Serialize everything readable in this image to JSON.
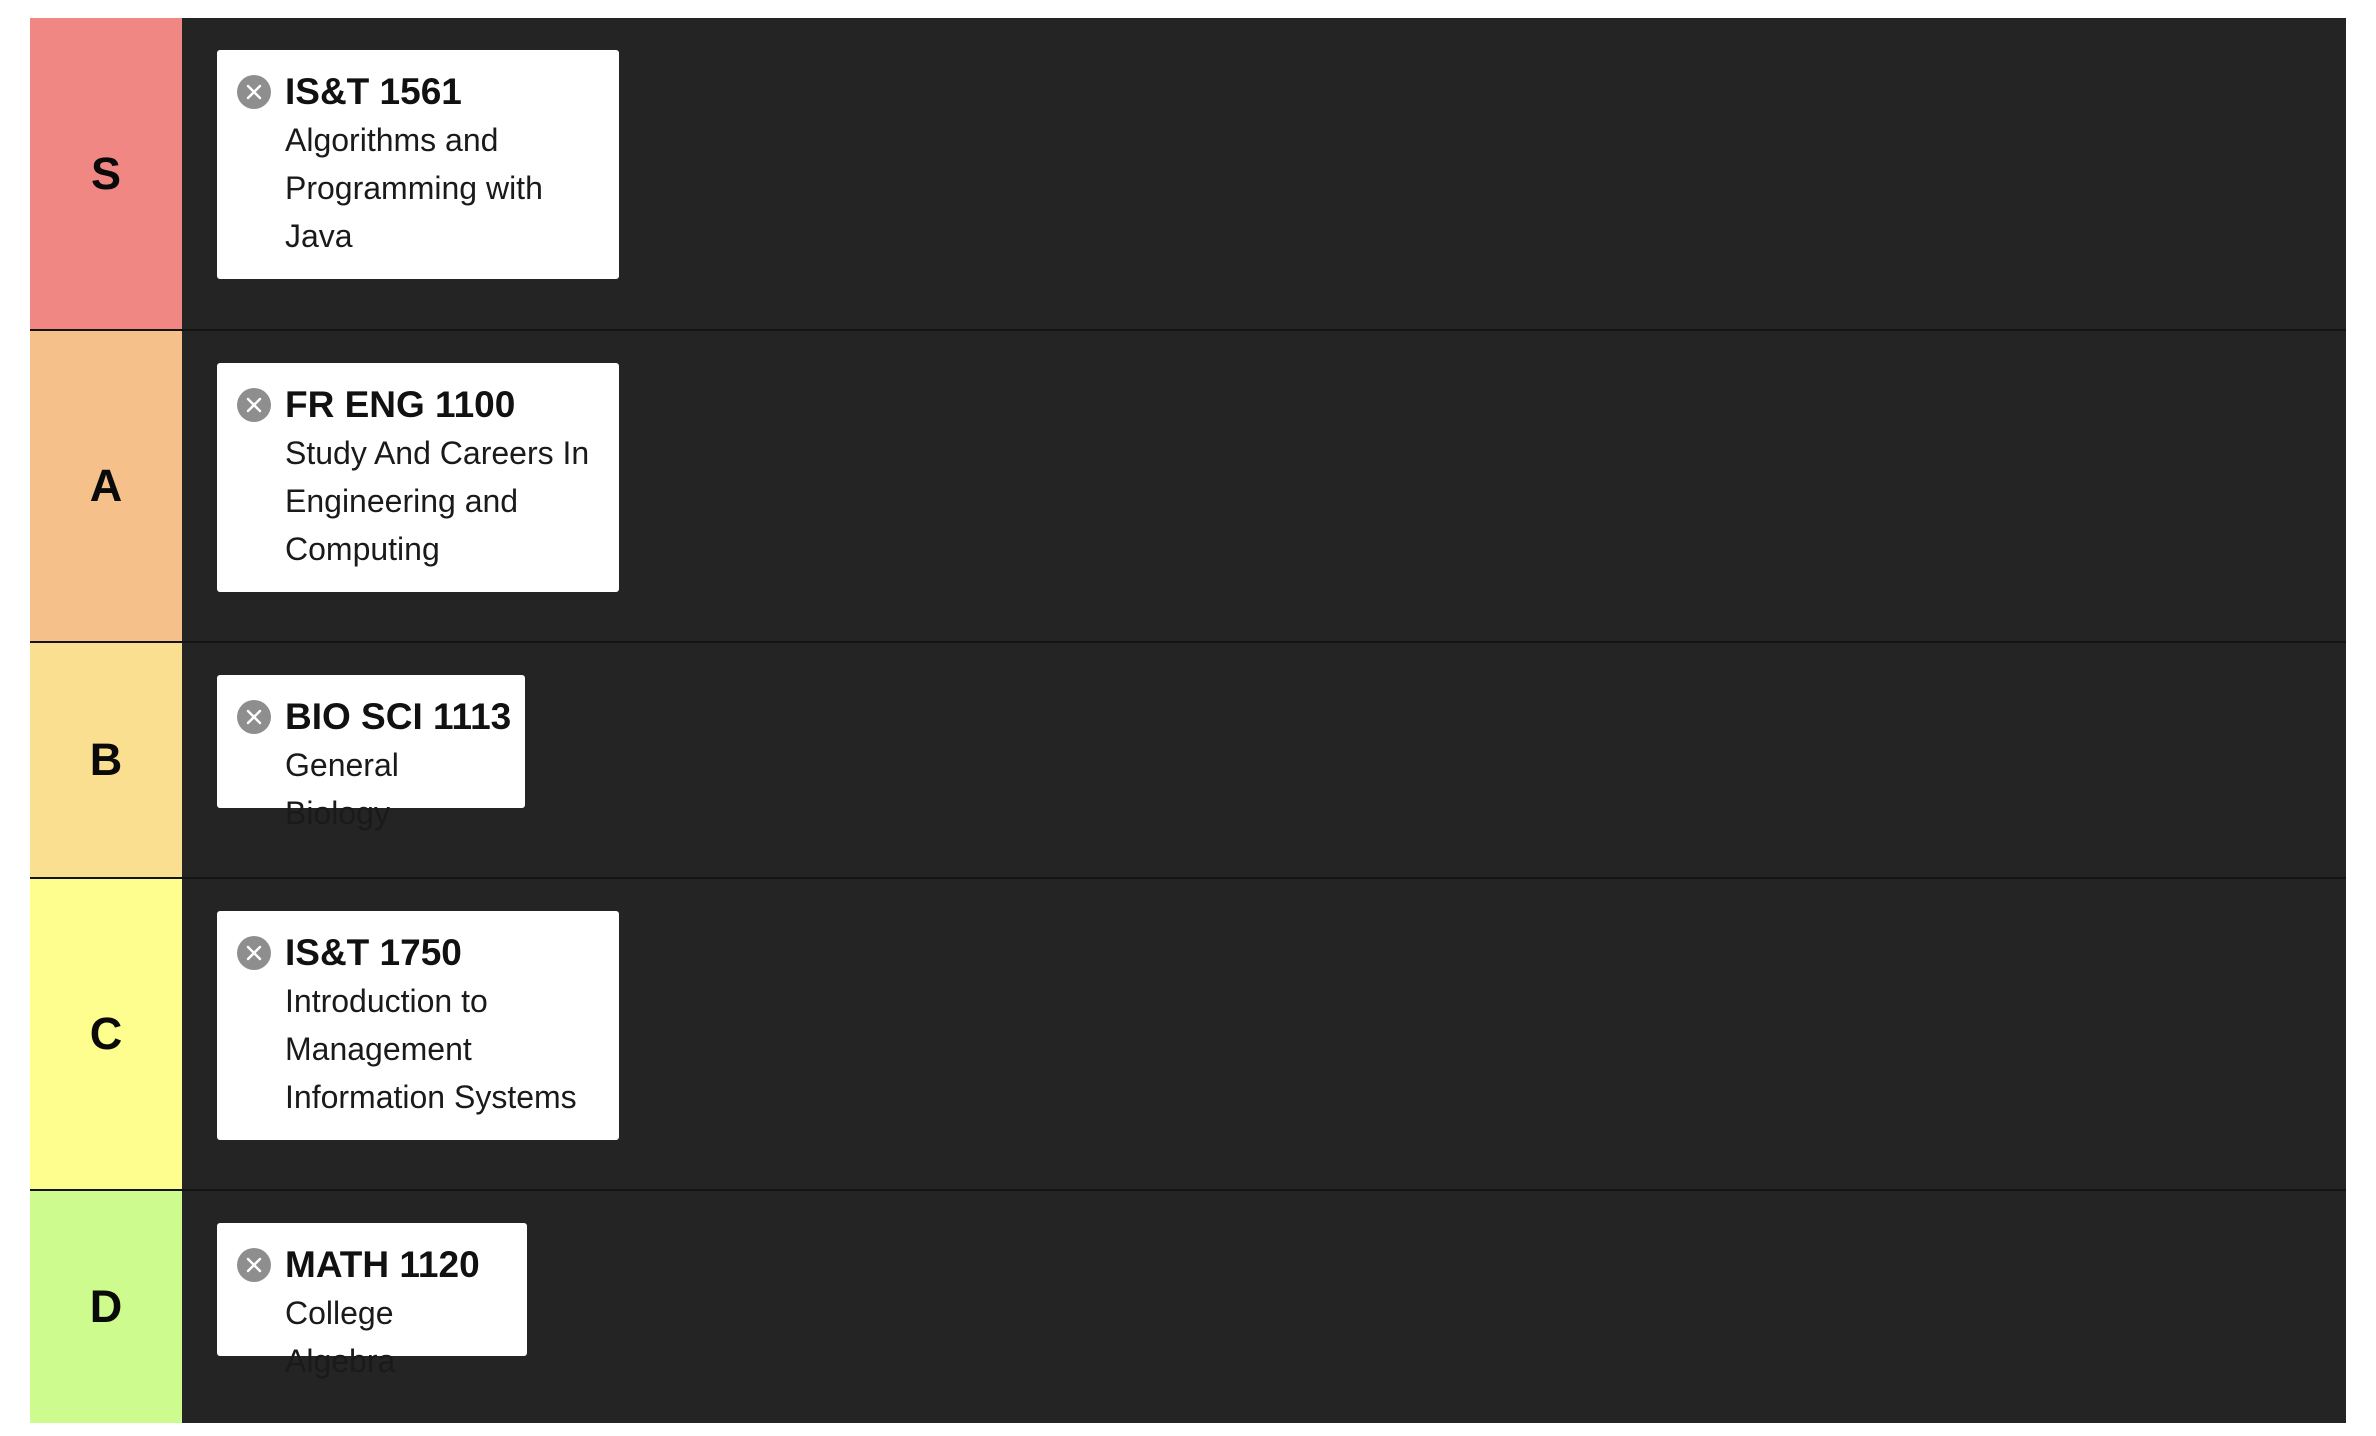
{
  "tiers": [
    {
      "label": "S",
      "color": "#f08782",
      "course": {
        "code": "IS&T 1561",
        "title": "Algorithms and Programming with Java"
      }
    },
    {
      "label": "A",
      "color": "#f5c08a",
      "course": {
        "code": "FR ENG 1100",
        "title": "Study And Careers In Engineering and Computing"
      }
    },
    {
      "label": "B",
      "color": "#f9df8f",
      "course": {
        "code": "BIO SCI 1113",
        "title": "General Biology"
      }
    },
    {
      "label": "C",
      "color": "#fefe8f",
      "course": {
        "code": "IS&T 1750",
        "title": "Introduction to Management Information Systems"
      }
    },
    {
      "label": "D",
      "color": "#cdfb8e",
      "course": {
        "code": "MATH 1120",
        "title": "College Algebra"
      }
    }
  ],
  "icons": {
    "remove": "close-circle-icon"
  }
}
